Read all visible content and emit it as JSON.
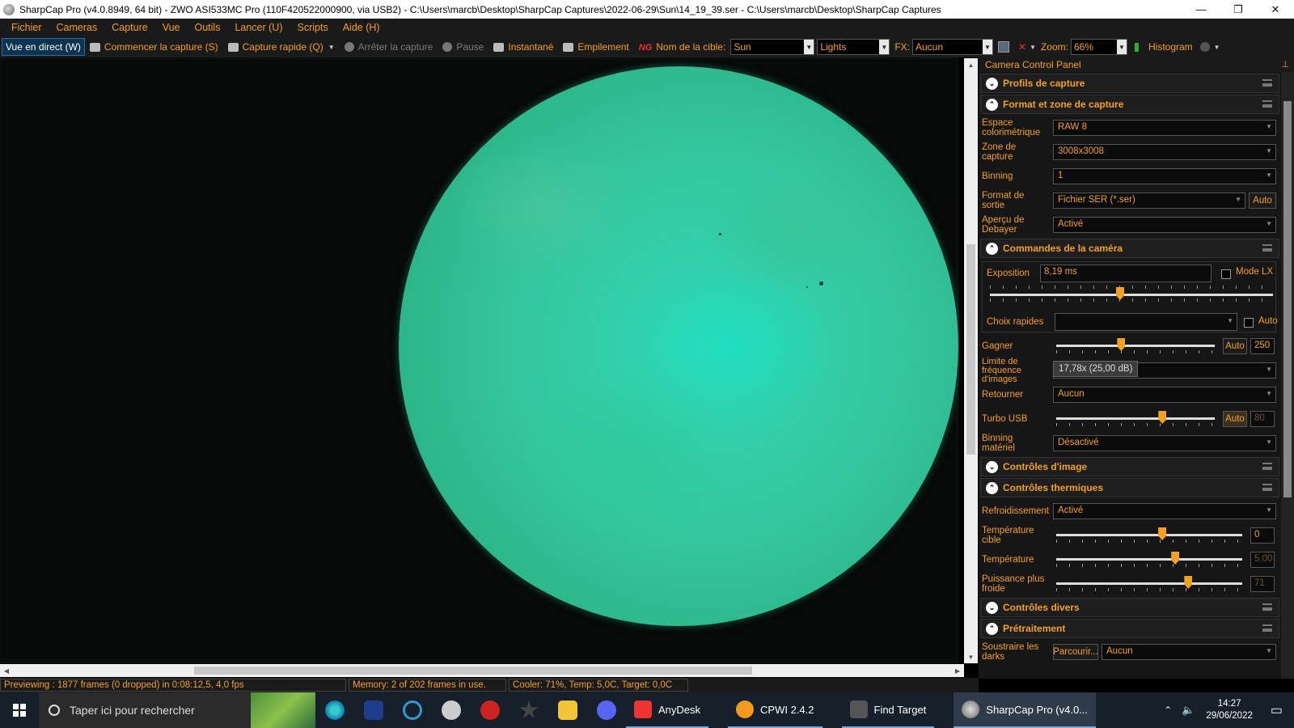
{
  "window": {
    "title": "SharpCap Pro (v4.0.8949, 64 bit) - ZWO ASI533MC Pro (110F420522000900, via USB2) - C:\\Users\\marcb\\Desktop\\SharpCap Captures\\2022-06-29\\Sun\\14_19_39.ser - C:\\Users\\marcb\\Desktop\\SharpCap Captures",
    "minimize": "—",
    "maximize": "❐",
    "close": "✕"
  },
  "menu": [
    "Fichier",
    "Cameras",
    "Capture",
    "Vue",
    "Outils",
    "Lancer (U)",
    "Scripts",
    "Aide (H)"
  ],
  "toolbar": {
    "live_view": "Vue en direct (W)",
    "start_capture": "Commencer la capture (S)",
    "quick_capture": "Capture rapide (Q)",
    "stop_capture": "Arrêter la capture",
    "pause": "Pause",
    "snapshot": "Instantané",
    "stacking": "Empilement",
    "target_label": "Nom de la cible:",
    "target_value": "Sun",
    "frame_type": "Lights",
    "fx_label": "FX:",
    "fx_value": "Aucun",
    "zoom_label": "Zoom:",
    "zoom_value": "66%",
    "histogram": "Histogram"
  },
  "status": {
    "preview": "Previewing : 1877 frames (0 dropped) in 0:08:12,5, 4,0 fps",
    "memory": "Memory: 2 of 202 frames in use.",
    "cooler": "Cooler: 71%, Temp: 5,0C, Target: 0,0C"
  },
  "panel": {
    "title": "Camera Control Panel",
    "pin": "⊥",
    "sections": {
      "profiles": "Profils de capture",
      "format": "Format et zone de capture",
      "camera": "Commandes de la caméra",
      "image": "Contrôles d'image",
      "thermal": "Contrôles thermiques",
      "misc": "Contrôles divers",
      "preprocess": "Prétraitement"
    },
    "format": {
      "colorspace_label": "Espace colorimétrique",
      "colorspace_value": "RAW 8",
      "roi_label": "Zone de capture",
      "roi_value": "3008x3008",
      "binning_label": "Binning",
      "binning_value": "1",
      "output_label": "Format de sortie",
      "output_value": "Fichier SER (*.ser)",
      "output_auto": "Auto",
      "debayer_label": "Aperçu de Debayer",
      "debayer_value": "Activé"
    },
    "camera": {
      "exposure_label": "Exposition",
      "exposure_value": "8,19 ms",
      "lx_label": "Mode LX",
      "exposure_slider": 0.46,
      "quick_label": "Choix rapides",
      "quick_value": "",
      "quick_auto": "Auto",
      "gain_label": "Gagner",
      "gain_auto": "Auto",
      "gain_value": "250",
      "gain_slider": 0.41,
      "fps_label": "Limite de fréquence d'images",
      "fps_tooltip": "17,78x (25,00 dB)",
      "flip_label": "Retourner",
      "flip_value": "Aucun",
      "usb_label": "Turbo USB",
      "usb_auto": "Auto",
      "usb_value": "80",
      "usb_slider": 0.67,
      "hwbin_label": "Binning matériel",
      "hwbin_value": "Désactivé"
    },
    "thermal": {
      "cooling_label": "Refroidissement",
      "cooling_value": "Activé",
      "target_label": "Température cible",
      "target_value": "0",
      "target_slider": 0.57,
      "temp_label": "Température",
      "temp_value": "5,00",
      "temp_slider": 0.64,
      "power_label": "Puissance plus froide",
      "power_value": "71",
      "power_slider": 0.71
    },
    "preprocess": {
      "darks_label": "Soustraire les darks",
      "browse": "Parcourir...",
      "darks_value": "Aucun"
    }
  },
  "taskbar": {
    "search_placeholder": "Taper ici pour rechercher",
    "apps": [
      "AnyDesk",
      "CPWI 2.4.2",
      "Find Target",
      "SharpCap Pro (v4.0..."
    ],
    "time": "14:27",
    "date": "29/06/2022"
  },
  "colors": {
    "accent": "#f4a020",
    "background": "#1a1a1a",
    "sun": "#2fd7b6"
  }
}
